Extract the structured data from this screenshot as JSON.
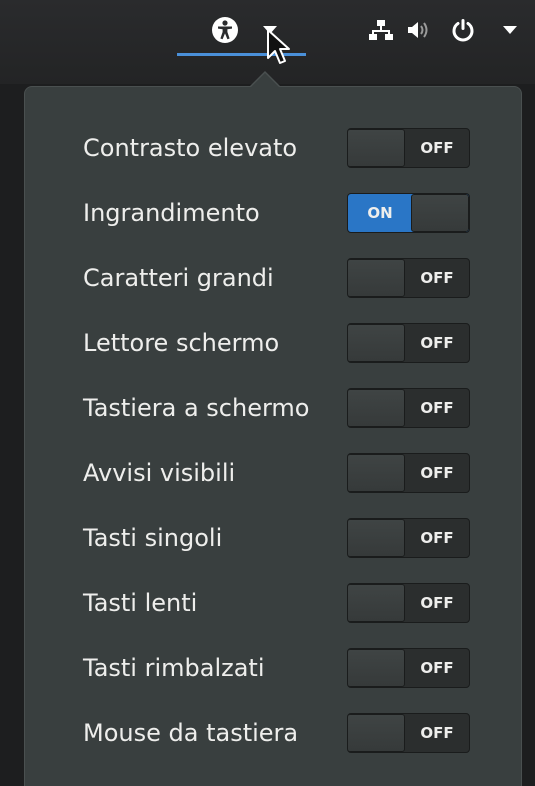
{
  "topbar": {
    "indicators": [
      {
        "icon": "accessibility-icon"
      },
      {
        "icon": "dropdown-arrow-icon"
      },
      {
        "icon": "network-wired-icon"
      },
      {
        "icon": "volume-icon"
      },
      {
        "icon": "power-icon"
      },
      {
        "icon": "system-menu-arrow-icon"
      }
    ],
    "accent": "#4a90d9"
  },
  "menu": {
    "items": [
      {
        "label": "Contrasto elevato",
        "state": "OFF",
        "on": false
      },
      {
        "label": "Ingrandimento",
        "state": "ON",
        "on": true
      },
      {
        "label": "Caratteri grandi",
        "state": "OFF",
        "on": false
      },
      {
        "label": "Lettore schermo",
        "state": "OFF",
        "on": false
      },
      {
        "label": "Tastiera a schermo",
        "state": "OFF",
        "on": false
      },
      {
        "label": "Avvisi visibili",
        "state": "OFF",
        "on": false
      },
      {
        "label": "Tasti singoli",
        "state": "OFF",
        "on": false
      },
      {
        "label": "Tasti lenti",
        "state": "OFF",
        "on": false
      },
      {
        "label": "Tasti rimbalzati",
        "state": "OFF",
        "on": false
      },
      {
        "label": "Mouse da tastiera",
        "state": "OFF",
        "on": false
      }
    ],
    "on_color": "#2a76c6",
    "background": "#393f3f"
  }
}
